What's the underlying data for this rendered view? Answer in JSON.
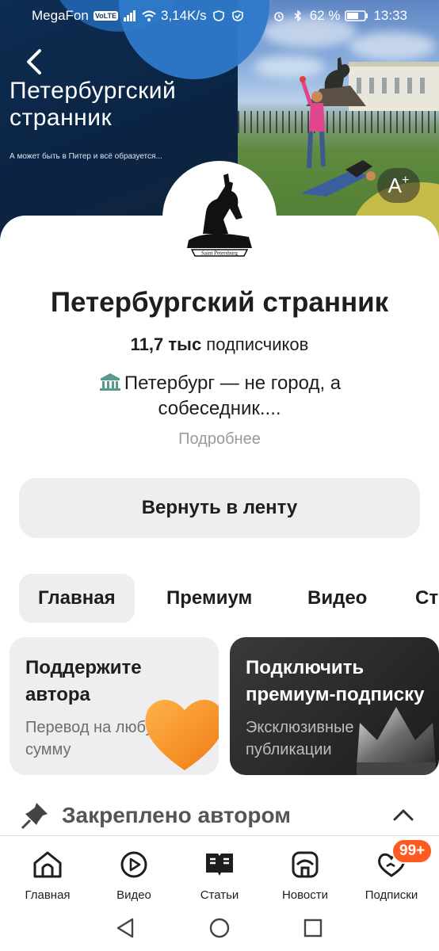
{
  "status_bar": {
    "carrier": "MegaFon",
    "volte": "VoLTE",
    "speed": "3,14K/s",
    "battery": "62 %",
    "time": "13:33"
  },
  "hero": {
    "title_line1": "Петербургский",
    "title_line2": "странник",
    "subtitle": "А может быть в Питер и всё образуется...",
    "font_button": "A",
    "font_button_sup": "+"
  },
  "avatar": {
    "caption": "Saint Petersburg"
  },
  "channel": {
    "name": "Петербургский странник",
    "subs_count": "11,7 тыс",
    "subs_label": " подписчиков",
    "description": "Петербург — не город, а собеседник....",
    "more": "Подробнее"
  },
  "return_button": "Вернуть в ленту",
  "tabs": [
    {
      "label": "Главная",
      "active": true
    },
    {
      "label": "Премиум",
      "active": false
    },
    {
      "label": "Видео",
      "active": false
    },
    {
      "label": "Ст",
      "active": false
    }
  ],
  "promos": [
    {
      "title": "Поддержите автора",
      "subtitle": "Перевод на любую сумму"
    },
    {
      "title": "Подключить премиум-подписку",
      "subtitle": "Эксклюзивные публикации"
    }
  ],
  "pinned": {
    "label": "Закреплено автором"
  },
  "bottom_nav": [
    {
      "label": "Главная",
      "icon": "home-icon"
    },
    {
      "label": "Видео",
      "icon": "video-icon"
    },
    {
      "label": "Статьи",
      "icon": "articles-icon"
    },
    {
      "label": "Новости",
      "icon": "news-icon"
    },
    {
      "label": "Подписки",
      "icon": "subscriptions-icon"
    }
  ],
  "subscriptions_badge": "99+",
  "colors": {
    "accent_badge": "#ff5a1f",
    "button_bg": "#eeeef0",
    "text_primary": "#1e1e1e",
    "text_secondary": "#9a9a9a"
  }
}
